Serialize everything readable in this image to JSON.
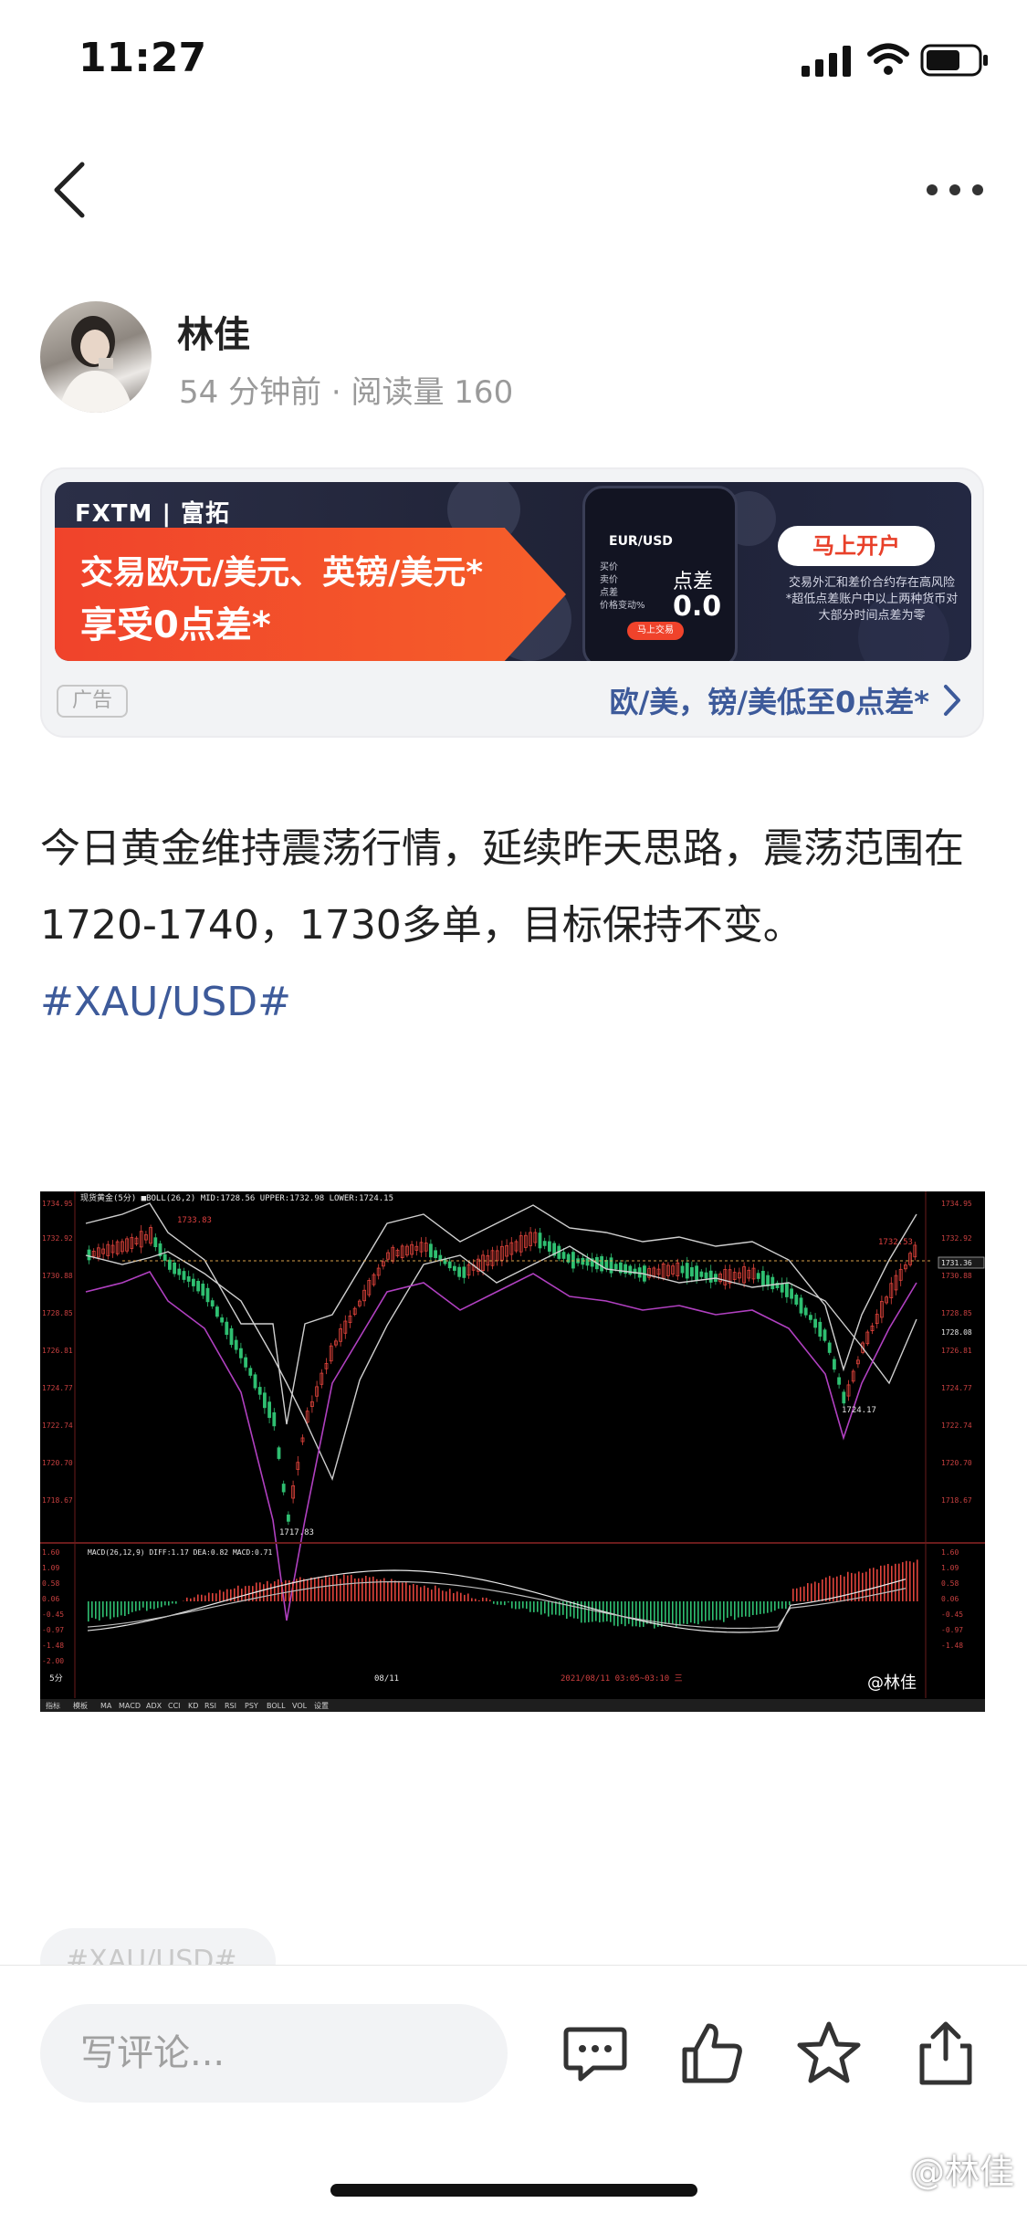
{
  "status_bar": {
    "time": "11:27"
  },
  "author": {
    "name": "林佳",
    "meta": "54 分钟前 · 阅读量 160"
  },
  "ad": {
    "logo_text": "FXTM | 富拓",
    "headline_1": "交易欧元/美元、英镑/美元*",
    "headline_2": "享受0点差*",
    "phone_pair": "EUR/USD",
    "phone_spread_label": "点差",
    "phone_spread_value": "0.0",
    "phone_rows": [
      "买价",
      "卖价",
      "点差",
      "价格变动%"
    ],
    "phone_button": "马上交易",
    "cta": "马上开户",
    "disclaimer": "交易外汇和差价合约存在高风险 *超低点差账户中以上两种货币对大部分时间点差为零",
    "label": "广告",
    "link_text": "欧/美，镑/美低至0点差*"
  },
  "post": {
    "text": "今日黄金维持震荡行情，延续昨天思路，震荡范围在1720-1740，1730多单，目标保持不变。",
    "hashtag": "#XAU/USD#"
  },
  "chart_image": {
    "header": "现货黄金(5分) ■BOLL(26,2) MID:1728.56 UPPER:1732.98 LOWER:1724.15",
    "price_labels": [
      "1734.95",
      "1732.92",
      "1730.88",
      "1728.85",
      "1726.81",
      "1724.77",
      "1722.74",
      "1720.70",
      "1718.67"
    ],
    "right_labels": [
      "1734.95",
      "1732.92",
      "1731.36",
      "1730.88",
      "1728.85",
      "1728.08",
      "1726.81",
      "1724.77",
      "1722.74",
      "1720.70",
      "1718.67"
    ],
    "annotations": {
      "high": "1733.83",
      "low": "1717.83",
      "recent_high": "1732.53",
      "recent_low": "1724.17"
    },
    "macd_header": "MACD(26,12,9) DIFF:1.17 DEA:0.82 MACD:0.71",
    "macd_labels": [
      "1.60",
      "1.09",
      "0.58",
      "0.06",
      "-0.45",
      "-0.97",
      "-1.48",
      "-2.00"
    ],
    "time_label": "08/11",
    "footer_time": "2021/08/11 03:05~03:10 三",
    "period": "5分",
    "tabs": [
      "指标",
      "模板",
      "MA",
      "MACD",
      "ADX",
      "CCI",
      "KD",
      "RSI",
      "RSI",
      "PSY",
      "BOLL",
      "VOL",
      "设置"
    ],
    "watermark": "@林佳"
  },
  "tag_chip": "#XAU/USD#",
  "bottom_bar": {
    "comment_placeholder": "写评论..."
  },
  "image_watermark": "@林佳",
  "icons": {
    "back": "chevron-left-icon",
    "more": "more-icon",
    "comment": "comment-icon",
    "like": "thumbs-up-icon",
    "favorite": "star-icon",
    "share": "share-icon"
  },
  "colors": {
    "link": "#3d5a9a",
    "ad_orange": "#f0432b",
    "candle_up": "#e0433b",
    "candle_down": "#2fbf71",
    "boll_mid": "#cfcfcf",
    "boll_lower": "#b040c0"
  }
}
